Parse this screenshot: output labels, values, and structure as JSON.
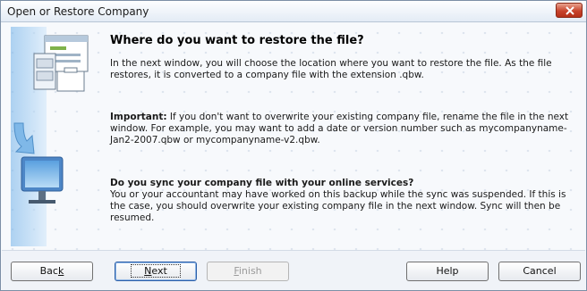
{
  "window": {
    "title": "Open or Restore Company"
  },
  "page": {
    "heading": "Where do you want to restore the file?",
    "intro": "In the next window, you will choose the location where you want to restore the file. As the file restores, it is converted to a company file with the extension .qbw.",
    "important_label": "Important:",
    "important_text": " If you don't want to overwrite your existing company file, rename the file in the next window. For example, you may want to add a date or version number such as mycompanyname-Jan2-2007.qbw or mycompanyname-v2.qbw.",
    "sync_heading": "Do you sync your company file with your online services?",
    "sync_text": "You or your accountant may have worked on this backup while the sync was suspended. If this is the case, you should overwrite your existing company file in the next window. Sync will then be resumed."
  },
  "buttons": {
    "back_pre": "Bac",
    "back_key": "k",
    "back_post": "",
    "next_pre": "",
    "next_key": "N",
    "next_post": "ext",
    "finish_pre": "",
    "finish_key": "F",
    "finish_post": "inish",
    "help": "Help",
    "cancel": "Cancel"
  },
  "colors": {
    "accent": "#2c5fa8",
    "close": "#c8442c"
  },
  "icons": [
    "file-cabinet-icon",
    "folder-icon",
    "arrow-down-icon",
    "computer-monitor-icon",
    "close-icon"
  ]
}
